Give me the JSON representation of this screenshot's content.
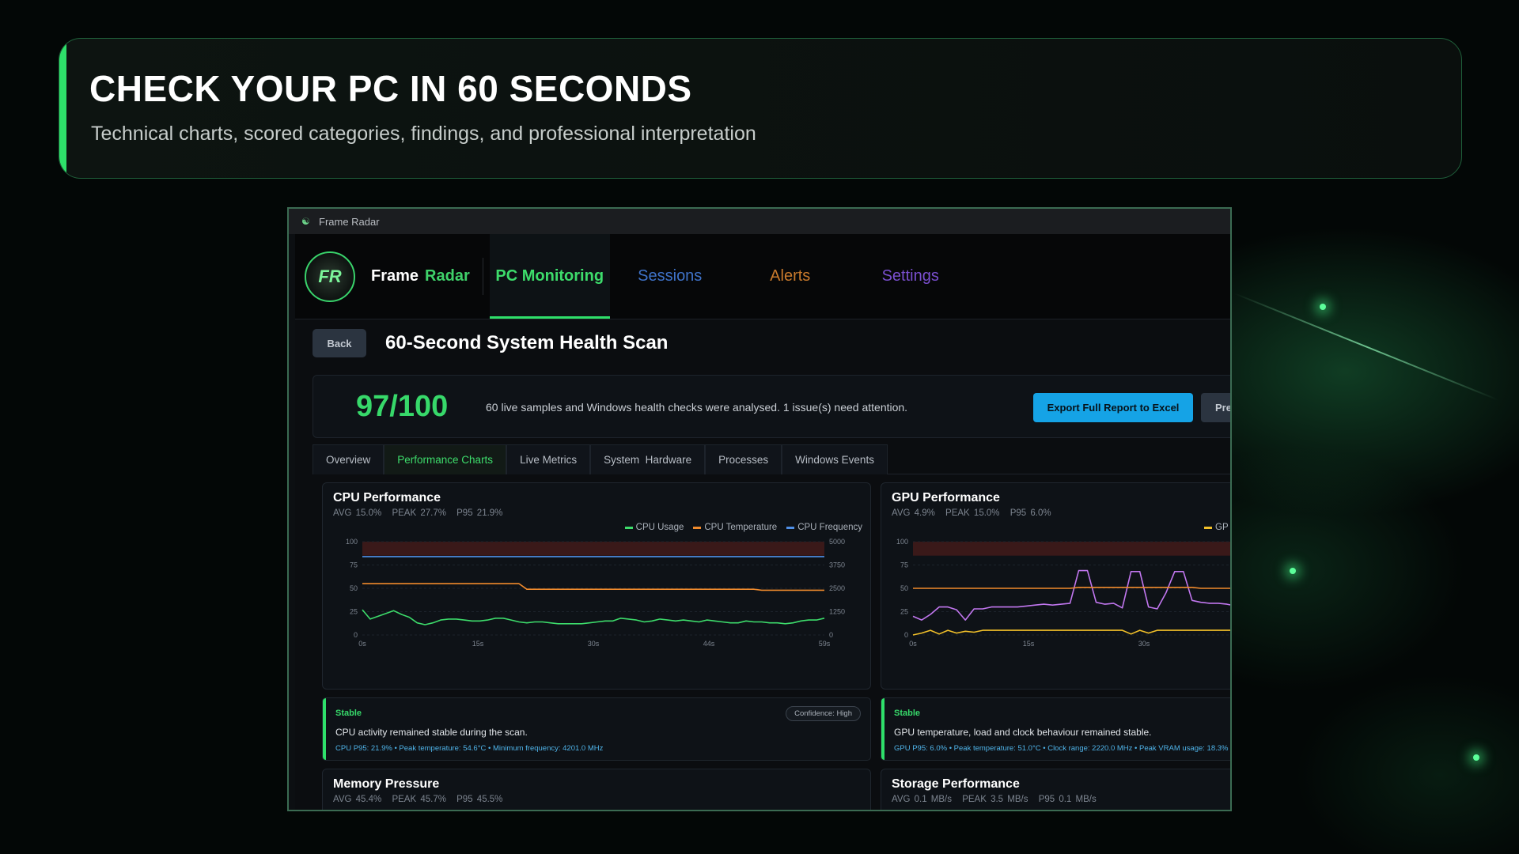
{
  "hero": {
    "title": "CHECK YOUR PC IN 60 SECONDS",
    "subtitle": "Technical charts, scored categories, findings, and professional interpretation"
  },
  "window": {
    "title": "Frame Radar"
  },
  "brand": {
    "logo_text": "FR",
    "name_first": "Frame",
    "name_second": "Radar"
  },
  "nav": {
    "tabs": [
      {
        "label": "PC Monitoring",
        "active": true,
        "color": "#3ddc6b"
      },
      {
        "label": "Sessions",
        "color": "#3f73c9"
      },
      {
        "label": "Alerts",
        "color": "#c97a2c"
      },
      {
        "label": "Settings",
        "color": "#7a4fcf"
      }
    ]
  },
  "page": {
    "back_label": "Back",
    "title": "60-Second System Health Scan",
    "score": "97/100",
    "summary": "60 live samples and Windows health checks were analysed. 1 issue(s) need attention.",
    "export_label": "Export Full Report to Excel",
    "second_button_label": "Pre"
  },
  "subtabs": [
    "Overview",
    "Performance Charts",
    "Live Metrics",
    "System  Hardware",
    "Processes",
    "Windows Events"
  ],
  "active_subtab": "Performance Charts",
  "cards": {
    "cpu": {
      "title": "CPU Performance",
      "avg": "AVG 15.0%",
      "peak": "PEAK 27.7%",
      "p95": "P95 21.9%",
      "legend": [
        "CPU Usage",
        "CPU Temperature",
        "CPU Frequency"
      ]
    },
    "gpu": {
      "title": "GPU Performance",
      "avg": "AVG 4.9%",
      "peak": "PEAK 15.0%",
      "p95": "P95 6.0%",
      "legend": [
        "GP"
      ]
    },
    "memory": {
      "title": "Memory Pressure",
      "avg": "AVG 45.4%",
      "peak": "PEAK 45.7%",
      "p95": "P95 45.5%"
    },
    "storage": {
      "title": "Storage Performance",
      "avg": "AVG 0.1 MB/s",
      "peak": "PEAK 3.5 MB/s",
      "p95": "P95 0.1 MB/s"
    }
  },
  "notes": {
    "cpu": {
      "status": "Stable",
      "text": "CPU activity remained stable during the scan.",
      "confidence": "Confidence: High",
      "detail": "CPU P95: 21.9%  •  Peak temperature: 54.6°C  •  Minimum frequency: 4201.0 MHz"
    },
    "gpu": {
      "status": "Stable",
      "text": "GPU temperature, load and clock behaviour remained stable.",
      "detail": "GPU P95: 6.0%  •  Peak temperature: 51.0°C  •  Clock range: 2220.0 MHz  •  Peak VRAM usage: 18.3%"
    }
  },
  "colors": {
    "accent": "#2ee06a",
    "usage": "#3ddc6b",
    "temperature": "#f08a2c",
    "frequency": "#4f8fe6",
    "gpu_load": "#c277f0",
    "gpu_yellow": "#f2c029",
    "export": "#15a3e6"
  },
  "chart_data": [
    {
      "type": "line",
      "title": "CPU Performance",
      "x_ticks": [
        "0s",
        "15s",
        "30s",
        "44s",
        "59s"
      ],
      "y_left_ticks": [
        0,
        25,
        50,
        75,
        100
      ],
      "y_right_ticks": [
        0,
        1250,
        2500,
        3750,
        5000
      ],
      "ylim": [
        0,
        100
      ],
      "y2lim": [
        0,
        5000
      ],
      "threshold_band": [
        85,
        100
      ],
      "x": [
        0,
        1,
        2,
        3,
        4,
        5,
        6,
        7,
        8,
        9,
        10,
        11,
        12,
        13,
        14,
        15,
        16,
        17,
        18,
        19,
        20,
        21,
        22,
        23,
        24,
        25,
        26,
        27,
        28,
        29,
        30,
        31,
        32,
        33,
        34,
        35,
        36,
        37,
        38,
        39,
        40,
        41,
        42,
        43,
        44,
        45,
        46,
        47,
        48,
        49,
        50,
        51,
        52,
        53,
        54,
        55,
        56,
        57,
        58,
        59
      ],
      "series": [
        {
          "name": "CPU Usage",
          "axis": "left",
          "color": "#3ddc6b",
          "values": [
            27,
            17,
            20,
            23,
            26,
            22,
            19,
            13,
            11,
            13,
            16,
            17,
            17,
            16,
            15,
            15,
            16,
            18,
            18,
            16,
            14,
            13,
            14,
            14,
            13,
            12,
            12,
            12,
            12,
            13,
            14,
            15,
            15,
            18,
            17,
            16,
            14,
            15,
            17,
            16,
            15,
            16,
            15,
            14,
            16,
            15,
            14,
            13,
            13,
            15,
            14,
            14,
            13,
            13,
            12,
            13,
            15,
            16,
            16,
            18
          ]
        },
        {
          "name": "CPU Temperature",
          "axis": "left",
          "color": "#f08a2c",
          "values": [
            55,
            55,
            55,
            55,
            55,
            55,
            55,
            55,
            55,
            55,
            55,
            55,
            55,
            55,
            55,
            55,
            55,
            55,
            55,
            55,
            55,
            49,
            49,
            49,
            49,
            49,
            49,
            49,
            49,
            49,
            49,
            49,
            49,
            49,
            49,
            49,
            49,
            49,
            49,
            49,
            49,
            49,
            49,
            49,
            49,
            49,
            49,
            49,
            49,
            49,
            49,
            48,
            48,
            48,
            48,
            48,
            48,
            48,
            48,
            48
          ]
        },
        {
          "name": "CPU Frequency",
          "axis": "right",
          "color": "#4f8fe6",
          "values": [
            4201,
            4201,
            4201,
            4201,
            4201,
            4201,
            4201,
            4201,
            4201,
            4201,
            4201,
            4201,
            4201,
            4201,
            4201,
            4201,
            4201,
            4201,
            4201,
            4201,
            4201,
            4201,
            4201,
            4201,
            4201,
            4201,
            4201,
            4201,
            4201,
            4201,
            4201,
            4201,
            4201,
            4201,
            4201,
            4201,
            4201,
            4201,
            4201,
            4201,
            4201,
            4201,
            4201,
            4201,
            4201,
            4201,
            4201,
            4201,
            4201,
            4201,
            4201,
            4201,
            4201,
            4201,
            4201,
            4201,
            4201,
            4201,
            4201,
            4201
          ]
        }
      ]
    },
    {
      "type": "line",
      "title": "GPU Performance",
      "x_ticks": [
        "0s",
        "15s",
        "30s"
      ],
      "y_left_ticks": [
        0,
        25,
        50,
        75,
        100
      ],
      "ylim": [
        0,
        100
      ],
      "threshold_band": [
        85,
        100
      ],
      "x": [
        0,
        1,
        2,
        3,
        4,
        5,
        6,
        7,
        8,
        9,
        10,
        11,
        12,
        13,
        14,
        15,
        16,
        17,
        18,
        19,
        20,
        21,
        22,
        23,
        24,
        25,
        26,
        27,
        28,
        29,
        30,
        31,
        32,
        33,
        34,
        35,
        36,
        37,
        38,
        39
      ],
      "series": [
        {
          "color": "#c277f0",
          "values": [
            20,
            16,
            22,
            30,
            30,
            27,
            16,
            28,
            28,
            30,
            30,
            30,
            30,
            31,
            32,
            33,
            32,
            33,
            34,
            69,
            69,
            35,
            33,
            34,
            29,
            68,
            68,
            30,
            28,
            45,
            68,
            68,
            37,
            35,
            34,
            34,
            33,
            31,
            33,
            34
          ]
        },
        {
          "color": "#f08a2c",
          "values": [
            50,
            50,
            50,
            50,
            50,
            50,
            50,
            50,
            50,
            50,
            50,
            50,
            50,
            50,
            50,
            50,
            50,
            50,
            50,
            51,
            51,
            51,
            51,
            51,
            51,
            51,
            51,
            51,
            51,
            51,
            51,
            51,
            51,
            50,
            50,
            50,
            50,
            50,
            50,
            50
          ]
        },
        {
          "color": "#f2c029",
          "values": [
            0,
            2,
            5,
            1,
            5,
            2,
            4,
            3,
            5,
            5,
            5,
            5,
            5,
            5,
            5,
            5,
            5,
            5,
            5,
            5,
            5,
            5,
            5,
            5,
            5,
            1,
            5,
            2,
            5,
            5,
            5,
            5,
            5,
            5,
            5,
            5,
            5,
            5,
            6,
            15
          ]
        }
      ]
    }
  ]
}
